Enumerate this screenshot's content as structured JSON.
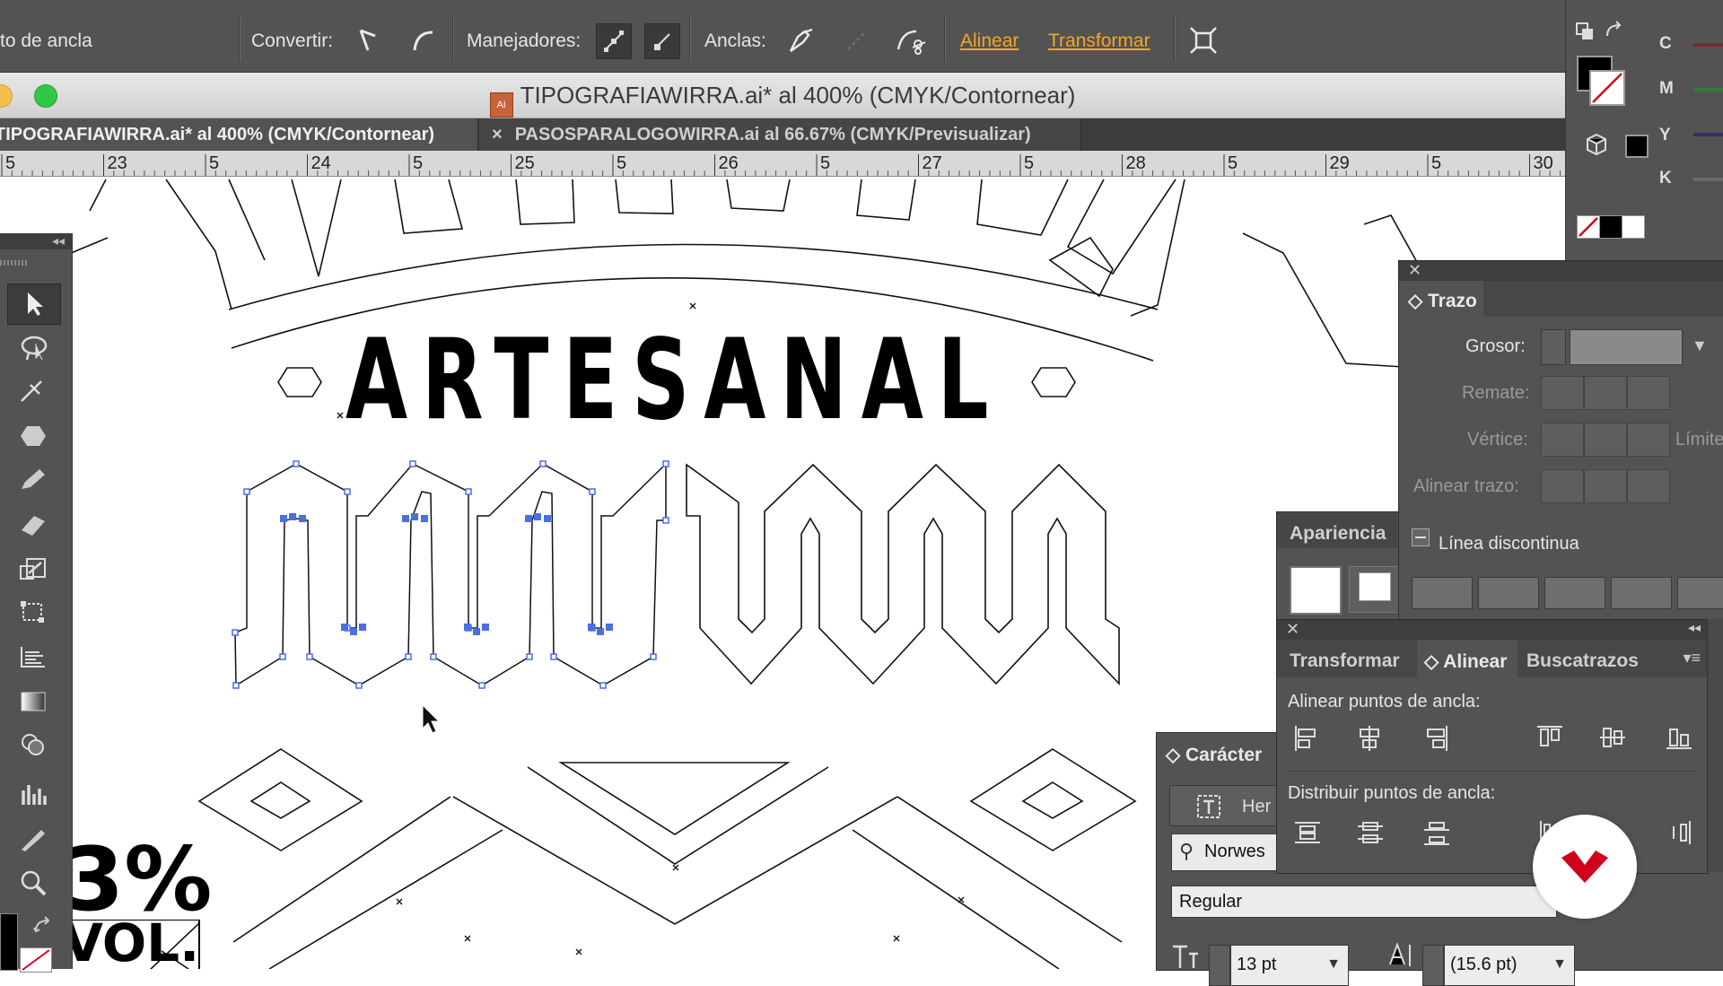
{
  "control_bar": {
    "anchor_label": "to de ancla",
    "convert_label": "Convertir:",
    "handles_label": "Manejadores:",
    "anchors_label": "Anclas:",
    "align_link": "Alinear",
    "transform_link": "Transformar"
  },
  "window": {
    "title": "TIPOGRAFIAWIRRA.ai* al 400% (CMYK/Contornear)"
  },
  "tabs": [
    {
      "label": "TIPOGRAFIAWIRRA.ai* al 400% (CMYK/Contornear)",
      "active": true
    },
    {
      "label": "PASOSPARALOGOWIRRA.ai al 66.67% (CMYK/Previsualizar)",
      "active": false
    }
  ],
  "tab_close_glyph": "×",
  "ruler": {
    "labels": [
      "5",
      "23",
      "5",
      "24",
      "5",
      "25",
      "5",
      "26",
      "5",
      "27",
      "5",
      "28",
      "5",
      "29",
      "5",
      "30"
    ]
  },
  "artwork": {
    "headline": "ARTESANAL",
    "percent_text": "3%",
    "vol_text": "VOL."
  },
  "color_panel": {
    "channels": [
      "C",
      "M",
      "Y",
      "K"
    ]
  },
  "trazo_panel": {
    "title": "Trazo",
    "weight_label": "Grosor:",
    "cap_label": "Remate:",
    "corner_label": "Vértice:",
    "limit_label": "Límite",
    "align_label": "Alinear trazo:",
    "dashed_label": "Línea discontinua"
  },
  "apariencia_panel": {
    "title": "Apariencia"
  },
  "align_panel": {
    "tabs": [
      "Transformar",
      "Alinear",
      "Buscatrazos"
    ],
    "active_tab": "Alinear",
    "align_anchors_label": "Alinear puntos de ancla:",
    "distribute_anchors_label": "Distribuir puntos de ancla:"
  },
  "character_panel": {
    "title": "Carácter",
    "touch_label": "Her",
    "font_search": "Norwes",
    "font_style": "Regular",
    "font_size": "13 pt",
    "leading": "(15.6 pt)"
  },
  "colors": {
    "panel_bg": "#535353",
    "accent_link": "#f5a623",
    "selection_blue": "#4a6fe0",
    "brand_red": "#d0021b"
  }
}
